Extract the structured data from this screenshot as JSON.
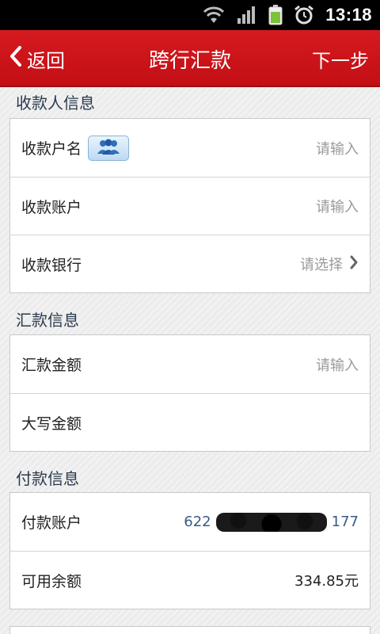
{
  "status_bar": {
    "time": "13:18",
    "icons": [
      "wifi-icon",
      "signal-icon",
      "battery-icon",
      "alarm-icon"
    ]
  },
  "header": {
    "back_label": "返回",
    "title": "跨行汇款",
    "next_label": "下一步"
  },
  "payee_section": {
    "title": "收款人信息",
    "rows": [
      {
        "label": "收款户名",
        "placeholder": "请输入"
      },
      {
        "label": "收款账户",
        "placeholder": "请输入"
      },
      {
        "label": "收款银行",
        "placeholder": "请选择"
      }
    ]
  },
  "remit_section": {
    "title": "汇款信息",
    "rows": [
      {
        "label": "汇款金额",
        "placeholder": "请输入"
      },
      {
        "label": "大写金额",
        "value": ""
      }
    ]
  },
  "payer_section": {
    "title": "付款信息",
    "rows": [
      {
        "label": "付款账户",
        "value_prefix": "622",
        "value_suffix": "177"
      },
      {
        "label": "可用余额",
        "value": "334.85元"
      }
    ]
  },
  "colors": {
    "header_red": "#d61a1f",
    "account_blue": "#3b5a88"
  }
}
